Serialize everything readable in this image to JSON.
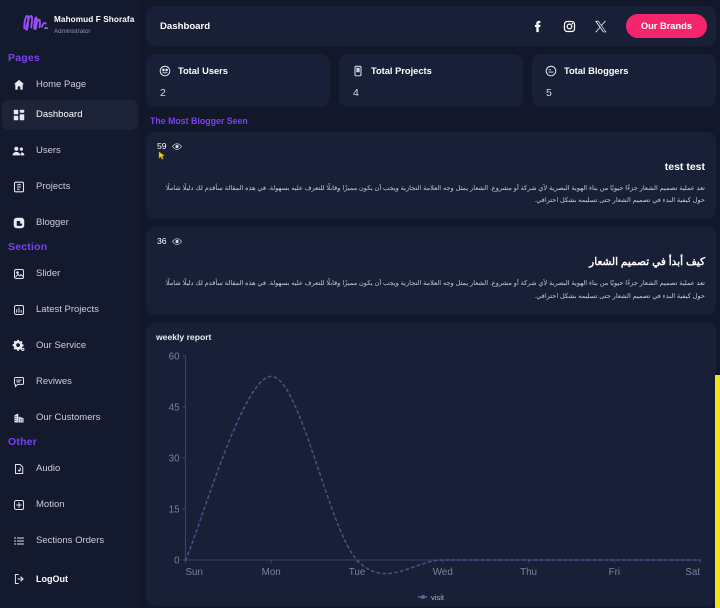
{
  "brand": {
    "logo_icon": "signature-logo",
    "name": "Mahomud F Shorafa",
    "role": "Administrator"
  },
  "sidebar": {
    "groups": [
      {
        "label": "Pages",
        "items": [
          {
            "icon": "home-icon",
            "label": "Home Page",
            "active": false
          },
          {
            "icon": "dashboard-grid-icon",
            "label": "Dashboard",
            "active": true
          },
          {
            "icon": "users-icon",
            "label": "Users",
            "active": false
          },
          {
            "icon": "projects-icon",
            "label": "Projects",
            "active": false
          },
          {
            "icon": "blogger-icon",
            "label": "Blogger",
            "active": false
          }
        ]
      },
      {
        "label": "Section",
        "items": [
          {
            "icon": "slider-image-icon",
            "label": "Slider",
            "active": false
          },
          {
            "icon": "latest-projects-icon",
            "label": "Latest Projects",
            "active": false
          },
          {
            "icon": "gear-icon",
            "label": "Our Service",
            "active": false
          },
          {
            "icon": "comment-icon",
            "label": "Reviwes",
            "active": false
          },
          {
            "icon": "building-icon",
            "label": "Our Customers",
            "active": false
          }
        ]
      },
      {
        "label": "Other",
        "items": [
          {
            "icon": "audio-file-icon",
            "label": "Audio",
            "active": false
          },
          {
            "icon": "motion-icon",
            "label": "Motion",
            "active": false
          },
          {
            "icon": "list-order-icon",
            "label": "Sections Orders",
            "active": false
          }
        ]
      }
    ],
    "logout": {
      "icon": "logout-icon",
      "label": "LogOut"
    }
  },
  "topbar": {
    "title": "Dashboard",
    "socials": [
      {
        "icon": "facebook-icon",
        "name": "Facebook"
      },
      {
        "icon": "instagram-icon",
        "name": "Instagram"
      },
      {
        "icon": "x-twitter-icon",
        "name": "X"
      }
    ],
    "brands_button": "Our Brands",
    "brands_button_color": "#f5256b"
  },
  "stats": [
    {
      "icon": "total-users-icon",
      "title": "Total Users",
      "value": "2"
    },
    {
      "icon": "total-projects-icon",
      "title": "Total Projects",
      "value": "4"
    },
    {
      "icon": "total-bloggers-icon",
      "title": "Total Bloggers",
      "value": "5"
    }
  ],
  "most_seen": {
    "heading": "The Most Blogger Seen",
    "heading_color": "#7b3ff2",
    "posts": [
      {
        "views": "59",
        "views_icon": "eye-icon",
        "title": "test test",
        "body": "تعد عملية تصميم الشعار جزءًا حيويًا من بناء الهوية البصرية لأي شركة أو مشروع. الشعار يمثل وجه العلامة التجارية ويجب أن يكون مميزًا وقابلًا للتعرف عليه بسهولة. في هذه المقالة سأقدم لك دليلًا شاملًا حول كيفية البدء في تصميم الشعار حتى تسليمه بشكل احترافي."
      },
      {
        "views": "36",
        "views_icon": "eye-icon",
        "title": "كيف أبدأ في تصميم الشعار",
        "body": "تعد عملية تصميم الشعار جزءًا حيويًا من بناء الهوية البصرية لأي شركة أو مشروع. الشعار يمثل وجه العلامة التجارية ويجب أن يكون مميزًا وقابلًا للتعرف عليه بسهولة. في هذه المقالة سأقدم لك دليلًا شاملًا حول كيفية البدء في تصميم الشعار حتى تسليمه بشكل احترافي."
      }
    ]
  },
  "chart_data": {
    "type": "line",
    "title": "weekly report",
    "categories": [
      "Sun",
      "Mon",
      "Tue",
      "Wed",
      "Thu",
      "Fri",
      "Sat"
    ],
    "series": [
      {
        "name": "visit",
        "values": [
          0,
          54,
          0,
          0,
          0,
          0,
          0
        ]
      }
    ],
    "xlabel": "",
    "ylabel": "",
    "ylim": [
      0,
      60
    ],
    "yticks": [
      0,
      15,
      30,
      45,
      60
    ],
    "grid": false,
    "legend_position": "bottom",
    "line_style": "dashed-smooth",
    "line_color": "#49538a"
  },
  "scrollbar": {
    "name": "page-scrollbar",
    "color": "#f2e318"
  }
}
